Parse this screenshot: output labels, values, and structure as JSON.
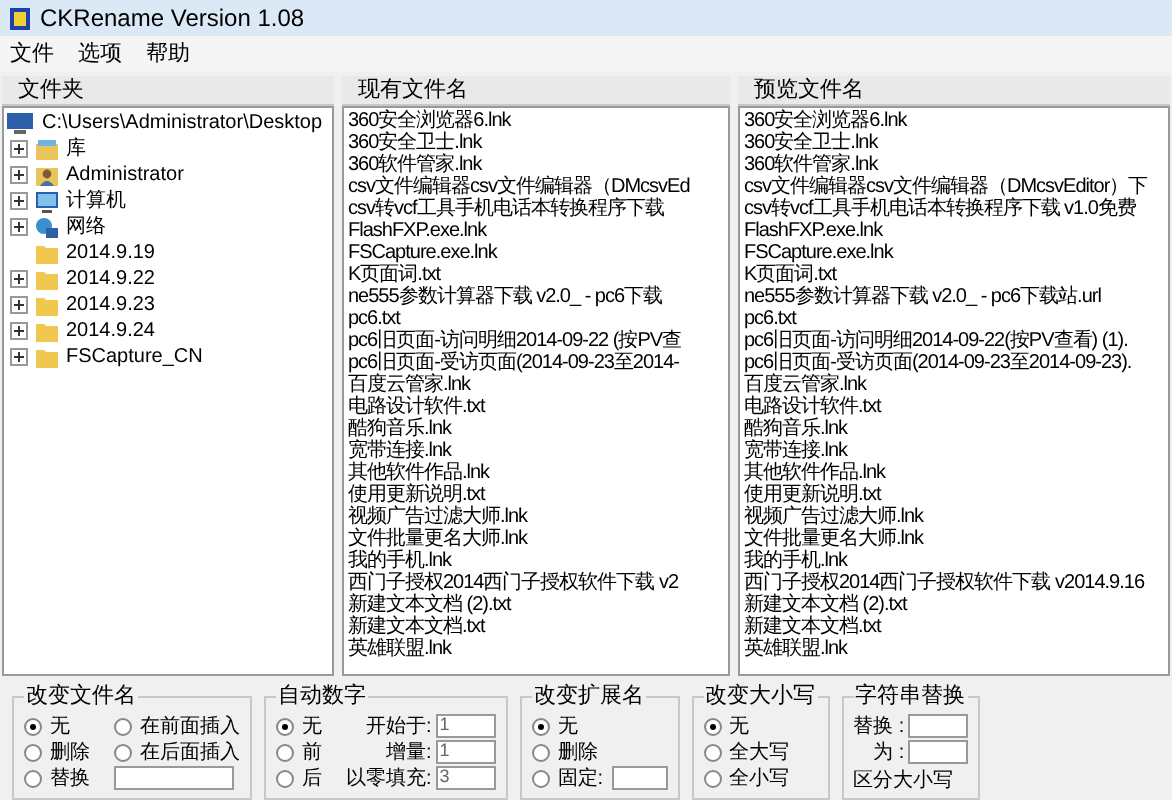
{
  "window": {
    "title": "CKRename Version 1.08"
  },
  "menu": [
    "文件",
    "选项",
    "帮助"
  ],
  "folders": {
    "header": "文件夹",
    "root": {
      "label": "C:\\Users\\Administrator\\Desktop",
      "children": [
        {
          "label": "库",
          "kind": "library",
          "expandable": true
        },
        {
          "label": "Administrator",
          "kind": "user",
          "expandable": true
        },
        {
          "label": "计算机",
          "kind": "computer",
          "expandable": true
        },
        {
          "label": "网络",
          "kind": "network",
          "expandable": true
        },
        {
          "label": "2014.9.19",
          "kind": "folder",
          "expandable": false
        },
        {
          "label": "2014.9.22",
          "kind": "folder",
          "expandable": true
        },
        {
          "label": "2014.9.23",
          "kind": "folder",
          "expandable": true
        },
        {
          "label": "2014.9.24",
          "kind": "folder",
          "expandable": true
        },
        {
          "label": "FSCapture_CN",
          "kind": "folder",
          "expandable": true
        }
      ]
    }
  },
  "current": {
    "header": "现有文件名",
    "files": [
      "360安全浏览器6.lnk",
      "360安全卫士.lnk",
      "360软件管家.lnk",
      "csv文件编辑器csv文件编辑器（DMcsvEd",
      "csv转vcf工具手机电话本转换程序下载",
      "FlashFXP.exe.lnk",
      "FSCapture.exe.lnk",
      "K页面词.txt",
      "ne555参数计算器下载 v2.0_ - pc6下载",
      "pc6.txt",
      "pc6旧页面-访问明细2014-09-22 (按PV查",
      "pc6旧页面-受访页面(2014-09-23至2014-",
      "百度云管家.lnk",
      "电路设计软件.txt",
      "酷狗音乐.lnk",
      "宽带连接.lnk",
      "其他软件作品.lnk",
      "使用更新说明.txt",
      "视频广告过滤大师.lnk",
      "文件批量更名大师.lnk",
      "我的手机.lnk",
      "西门子授权2014西门子授权软件下载 v2",
      "新建文本文档 (2).txt",
      "新建文本文档.txt",
      "英雄联盟.lnk"
    ]
  },
  "preview": {
    "header": "预览文件名",
    "files": [
      "360安全浏览器6.lnk",
      "360安全卫士.lnk",
      "360软件管家.lnk",
      "csv文件编辑器csv文件编辑器（DMcsvEditor）下",
      "csv转vcf工具手机电话本转换程序下载 v1.0免费",
      "FlashFXP.exe.lnk",
      "FSCapture.exe.lnk",
      "K页面词.txt",
      "ne555参数计算器下载 v2.0_ - pc6下载站.url",
      "pc6.txt",
      "pc6旧页面-访问明细2014-09-22(按PV查看) (1).",
      "pc6旧页面-受访页面(2014-09-23至2014-09-23).",
      "百度云管家.lnk",
      "电路设计软件.txt",
      "酷狗音乐.lnk",
      "宽带连接.lnk",
      "其他软件作品.lnk",
      "使用更新说明.txt",
      "视频广告过滤大师.lnk",
      "文件批量更名大师.lnk",
      "我的手机.lnk",
      "西门子授权2014西门子授权软件下载 v2014.9.16",
      "新建文本文档 (2).txt",
      "新建文本文档.txt",
      "英雄联盟.lnk"
    ]
  },
  "groups": [
    {
      "title": "改变文件名",
      "items": [
        {
          "kind": "radio",
          "label": "无",
          "selected": true
        },
        {
          "kind": "radio",
          "label": "删除",
          "selected": false
        },
        {
          "kind": "radio",
          "label": "替换",
          "selected": false
        },
        {
          "kind": "radio",
          "label": "在前面插入",
          "selected": false
        },
        {
          "kind": "radio",
          "label": "在后面插入",
          "selected": false
        },
        {
          "kind": "input"
        }
      ]
    },
    {
      "title": "自动数字",
      "items": [
        {
          "kind": "radio",
          "label": "无",
          "selected": true
        },
        {
          "kind": "radio",
          "label": "前",
          "selected": false
        },
        {
          "kind": "radio",
          "label": "后",
          "selected": false
        },
        {
          "kind": "field",
          "label": "开始于:",
          "value": "1"
        },
        {
          "kind": "field",
          "label": "增量:",
          "value": "1"
        },
        {
          "kind": "field",
          "label": "以零填充:",
          "value": "3"
        }
      ]
    },
    {
      "title": "改变扩展名",
      "items": [
        {
          "kind": "radio",
          "label": "无",
          "selected": true
        },
        {
          "kind": "radio",
          "label": "删除",
          "selected": false
        },
        {
          "kind": "radio-input",
          "label": "固定:",
          "selected": false
        }
      ]
    },
    {
      "title": "改变大小写",
      "items": [
        {
          "kind": "radio",
          "label": "无",
          "selected": true
        },
        {
          "kind": "radio",
          "label": "全大写",
          "selected": false
        },
        {
          "kind": "radio",
          "label": "全小写",
          "selected": false
        }
      ]
    },
    {
      "title": "字符串替换",
      "items": [
        {
          "kind": "field",
          "label": "替换 :"
        },
        {
          "kind": "field",
          "label": "为 :"
        },
        {
          "kind": "label",
          "label": "区分大小写"
        }
      ]
    }
  ]
}
